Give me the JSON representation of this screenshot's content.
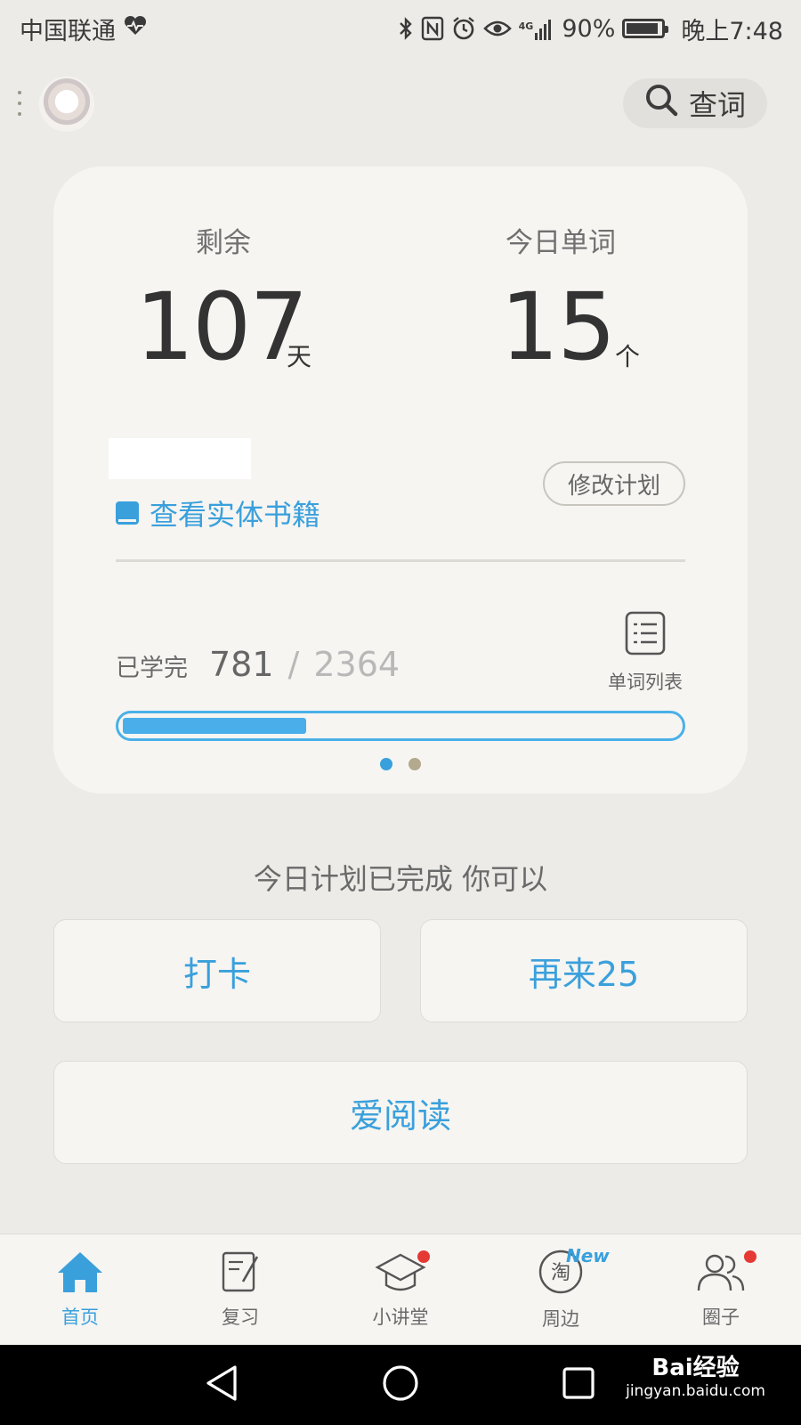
{
  "status_bar": {
    "carrier": "中国联通",
    "network": "4G",
    "battery": "90%",
    "time": "晚上7:48"
  },
  "header": {
    "search_label": "查词"
  },
  "plan_card": {
    "remaining_label": "剩余",
    "remaining_value": "107",
    "remaining_unit": "天",
    "today_label": "今日单词",
    "today_value": "15",
    "today_unit": "个",
    "book_link": "查看实体书籍",
    "modify_button": "修改计划",
    "learned_label": "已学完",
    "learned_count": "781",
    "separator": "/",
    "total_count": "2364",
    "word_list_label": "单词列表",
    "progress_fraction": 0.33,
    "page_indicator": {
      "pages": 2,
      "active": 0
    }
  },
  "plan_done_text": "今日计划已完成 你可以",
  "actions": {
    "checkin": "打卡",
    "more": "再来25",
    "read": "爱阅读"
  },
  "bottom_nav": [
    {
      "label": "首页",
      "icon": "home-icon",
      "active": true
    },
    {
      "label": "复习",
      "icon": "review-icon",
      "active": false
    },
    {
      "label": "小讲堂",
      "icon": "graduation-cap-icon",
      "active": false,
      "badge": "dot"
    },
    {
      "label": "周边",
      "icon": "tao-shop-icon",
      "active": false,
      "badge": "New"
    },
    {
      "label": "圈子",
      "icon": "people-icon",
      "active": false,
      "badge": "dot"
    }
  ],
  "watermark": {
    "brand": "Bai经验",
    "url": "jingyan.baidu.com"
  },
  "colors": {
    "accent": "#3aa0dc",
    "background": "#ecebe7",
    "card": "#f6f5f2",
    "badge_red": "#e53935",
    "dot_inactive": "#b2a98f"
  }
}
